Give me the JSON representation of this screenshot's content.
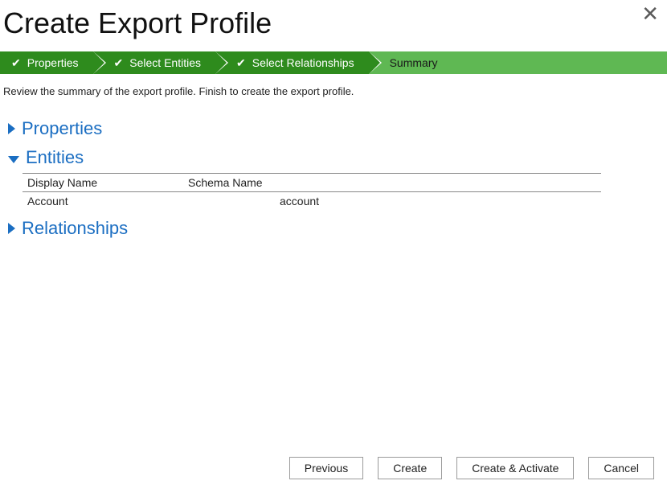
{
  "title": "Create Export Profile",
  "wizard": {
    "steps": [
      {
        "label": "Properties",
        "completed": true,
        "current": false
      },
      {
        "label": "Select Entities",
        "completed": true,
        "current": false
      },
      {
        "label": "Select Relationships",
        "completed": true,
        "current": false
      },
      {
        "label": "Summary",
        "completed": false,
        "current": true
      }
    ]
  },
  "instructions": "Review the summary of the export profile. Finish to create the export profile.",
  "sections": {
    "properties": {
      "label": "Properties",
      "expanded": false
    },
    "entities": {
      "label": "Entities",
      "expanded": true,
      "columns": {
        "display": "Display Name",
        "schema": "Schema Name"
      },
      "rows": [
        {
          "display": "Account",
          "schema": "account"
        }
      ]
    },
    "relationships": {
      "label": "Relationships",
      "expanded": false
    }
  },
  "buttons": {
    "previous": "Previous",
    "create": "Create",
    "create_activate": "Create & Activate",
    "cancel": "Cancel"
  }
}
